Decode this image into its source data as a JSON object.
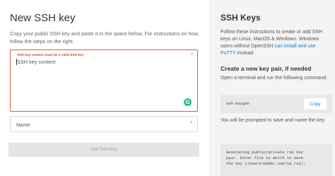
{
  "left": {
    "title": "New SSH key",
    "intro": "Copy your public SSH key and paste it in the space below. For instructions on how, follow the steps on the right.",
    "key_field": {
      "error": "SSH key content must be a valid SSH key",
      "placeholder": "SSH key content",
      "required_marker": "*"
    },
    "name_field": {
      "placeholder": "Name",
      "required_marker": "*"
    },
    "add_button": "Add SSH Key"
  },
  "right": {
    "title": "SSH Keys",
    "intro_before": "Follow these instructions to create or add SSH keys on Linux, MacOS & Windows. Windows users without OpenSSH ",
    "intro_link": "can install and use PuTTY",
    "intro_after": " instead.",
    "subheading": "Create a new key pair, if needed",
    "step1": "Open a terminal and run the following command:",
    "command": "ssh-keygen",
    "copy_button": "Copy",
    "step2": "You will be prompted to save and name the key.",
    "output_lines": [
      "Generating public/private rsa key",
      "pair. Enter file in which to save",
      "the key (/Users/USER/.ssh/id_rsa):"
    ]
  },
  "colors": {
    "error": "#d13f2b",
    "link": "#0b7bd8",
    "grammarly": "#15c39a"
  },
  "icons": {
    "grammarly": "grammarly-icon"
  }
}
